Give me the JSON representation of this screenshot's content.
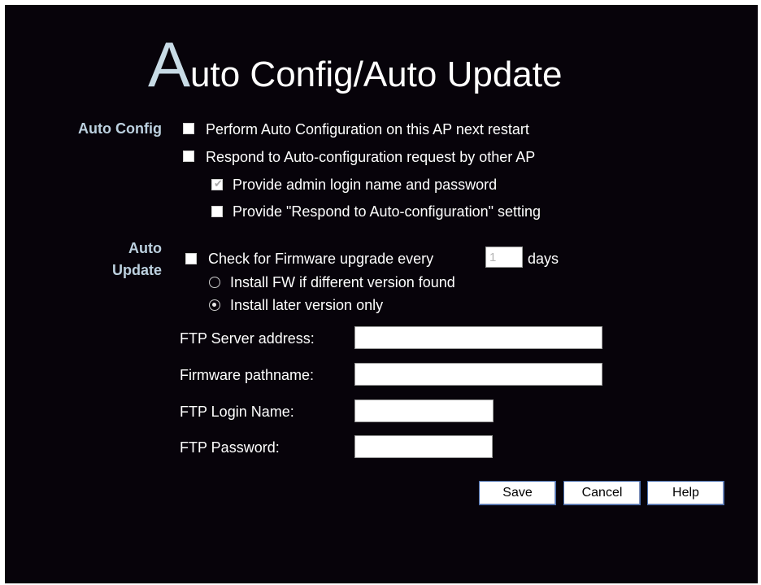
{
  "title": {
    "initial": "A",
    "rest": "uto Config/Auto Update"
  },
  "auto_config": {
    "label": "Auto Config",
    "options": [
      {
        "label": "Perform Auto Configuration on this AP next restart",
        "checked": false
      },
      {
        "label": "Respond to Auto-configuration request by other AP",
        "checked": false
      },
      {
        "label": "Provide admin login name and password",
        "checked": true,
        "disabled": true
      },
      {
        "label": "Provide \"Respond to Auto-configuration\" setting",
        "checked": false
      }
    ]
  },
  "auto_update": {
    "label_line1": "Auto",
    "label_line2": "Update",
    "check_prefix": "Check for Firmware upgrade every",
    "days_value": "1",
    "days_suffix": "days",
    "radio_different": "Install FW if different version found",
    "radio_later": "Install later version only",
    "selected_radio": "later"
  },
  "ftp": {
    "server_label": "FTP Server address:",
    "server_value": "",
    "path_label": "Firmware pathname:",
    "path_value": "",
    "login_label": "FTP Login Name:",
    "login_value": "",
    "password_label": "FTP Password:",
    "password_value": ""
  },
  "buttons": {
    "save": "Save",
    "cancel": "Cancel",
    "help": "Help"
  }
}
